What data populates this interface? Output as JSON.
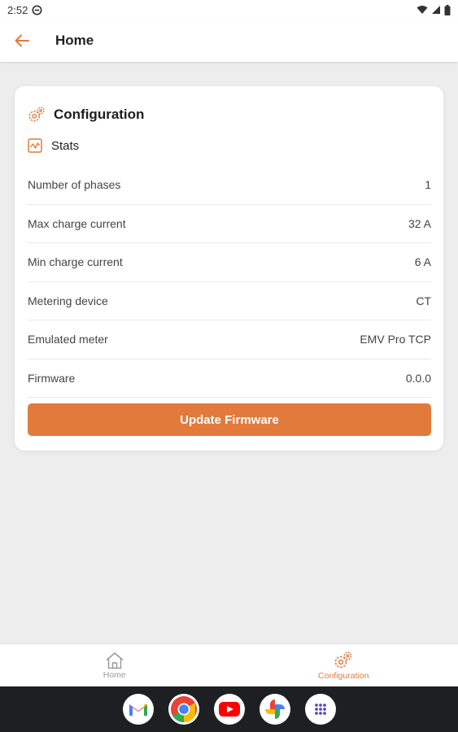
{
  "status_bar": {
    "time": "2:52"
  },
  "app_bar": {
    "title": "Home"
  },
  "card": {
    "title": "Configuration",
    "section": "Stats",
    "rows": [
      {
        "label": "Number of phases",
        "value": "1"
      },
      {
        "label": "Max charge current",
        "value": "32 A"
      },
      {
        "label": "Min charge current",
        "value": "6 A"
      },
      {
        "label": "Metering device",
        "value": "CT"
      },
      {
        "label": "Emulated meter",
        "value": "EMV Pro TCP"
      },
      {
        "label": "Firmware",
        "value": "0.0.0"
      }
    ],
    "button_label": "Update Firmware"
  },
  "bottom_nav": {
    "items": [
      {
        "label": "Home",
        "icon": "home-icon",
        "active": false
      },
      {
        "label": "Configuration",
        "icon": "gears-icon",
        "active": true
      }
    ]
  },
  "taskbar": {
    "apps": [
      "gmail-icon",
      "chrome-icon",
      "youtube-icon",
      "photos-icon",
      "app-drawer-icon"
    ]
  },
  "colors": {
    "accent": "#e27a3c",
    "background": "#ededed",
    "card": "#ffffff",
    "taskbar": "#1e1f22"
  }
}
